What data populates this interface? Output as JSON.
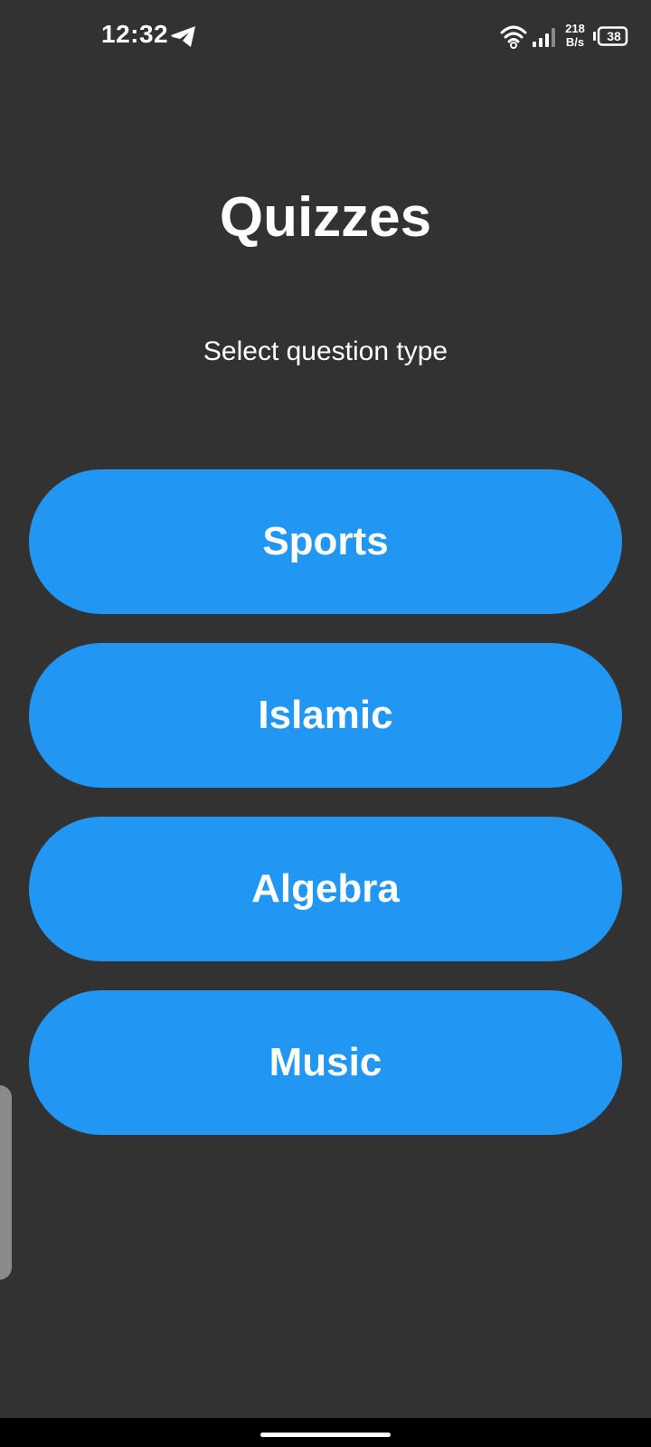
{
  "status_bar": {
    "time": "12:32",
    "net_speed_value": "218",
    "net_speed_unit": "B/s",
    "battery_level": "38",
    "icons": [
      "telegram-icon",
      "wifi-icon",
      "signal-icon",
      "battery-icon"
    ]
  },
  "header": {
    "title": "Quizzes",
    "subtitle": "Select question type"
  },
  "quiz_types": [
    {
      "label": "Sports"
    },
    {
      "label": "Islamic"
    },
    {
      "label": "Algebra"
    },
    {
      "label": "Music"
    }
  ],
  "colors": {
    "background": "#323232",
    "button": "#2196f3",
    "text": "#ffffff",
    "nav_bar": "#000000"
  }
}
